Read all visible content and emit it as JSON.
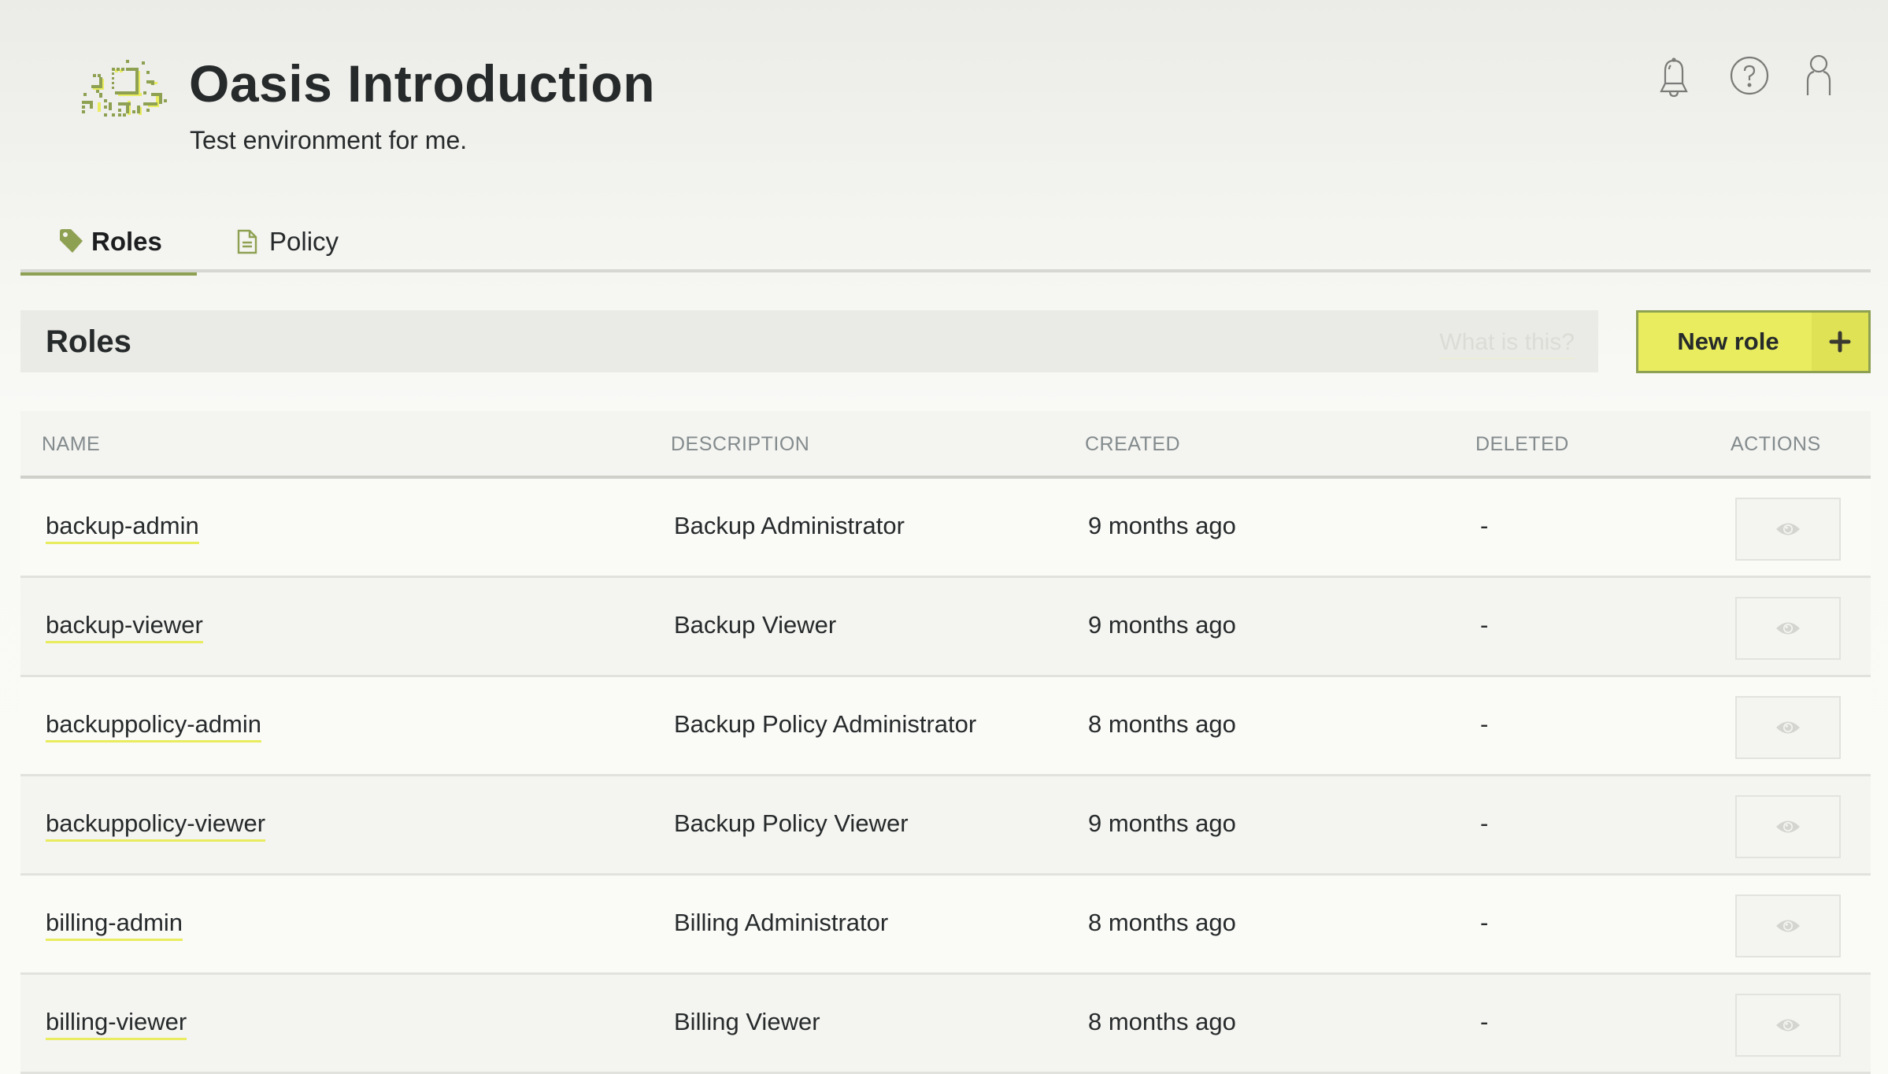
{
  "header": {
    "title": "Oasis Introduction",
    "subtitle": "Test environment for me.",
    "icons": [
      "bell-icon",
      "help-icon",
      "user-icon"
    ]
  },
  "tabs": [
    {
      "label": "Roles",
      "icon": "tag-icon",
      "active": true
    },
    {
      "label": "Policy",
      "icon": "document-icon",
      "active": false
    }
  ],
  "section": {
    "title": "Roles",
    "help_link": "What is this?",
    "new_button_label": "New role",
    "new_button_icon": "plus-icon"
  },
  "table": {
    "columns": [
      "NAME",
      "DESCRIPTION",
      "CREATED",
      "DELETED",
      "ACTIONS"
    ],
    "rows": [
      {
        "name": "backup-admin",
        "description": "Backup Administrator",
        "created": "9 months ago",
        "deleted": "-",
        "action": "view"
      },
      {
        "name": "backup-viewer",
        "description": "Backup Viewer",
        "created": "9 months ago",
        "deleted": "-",
        "action": "view"
      },
      {
        "name": "backuppolicy-admin",
        "description": "Backup Policy Administrator",
        "created": "8 months ago",
        "deleted": "-",
        "action": "view"
      },
      {
        "name": "backuppolicy-viewer",
        "description": "Backup Policy Viewer",
        "created": "9 months ago",
        "deleted": "-",
        "action": "view"
      },
      {
        "name": "billing-admin",
        "description": "Billing Administrator",
        "created": "8 months ago",
        "deleted": "-",
        "action": "view"
      },
      {
        "name": "billing-viewer",
        "description": "Billing Viewer",
        "created": "8 months ago",
        "deleted": "-",
        "action": "view"
      }
    ]
  },
  "colors": {
    "accent_green": "#8ea152",
    "button_yellow": "#e8ec5e",
    "link_underline": "#e8ec5e",
    "text_dark": "#262a2b",
    "header_text_gray": "#838b8d"
  }
}
